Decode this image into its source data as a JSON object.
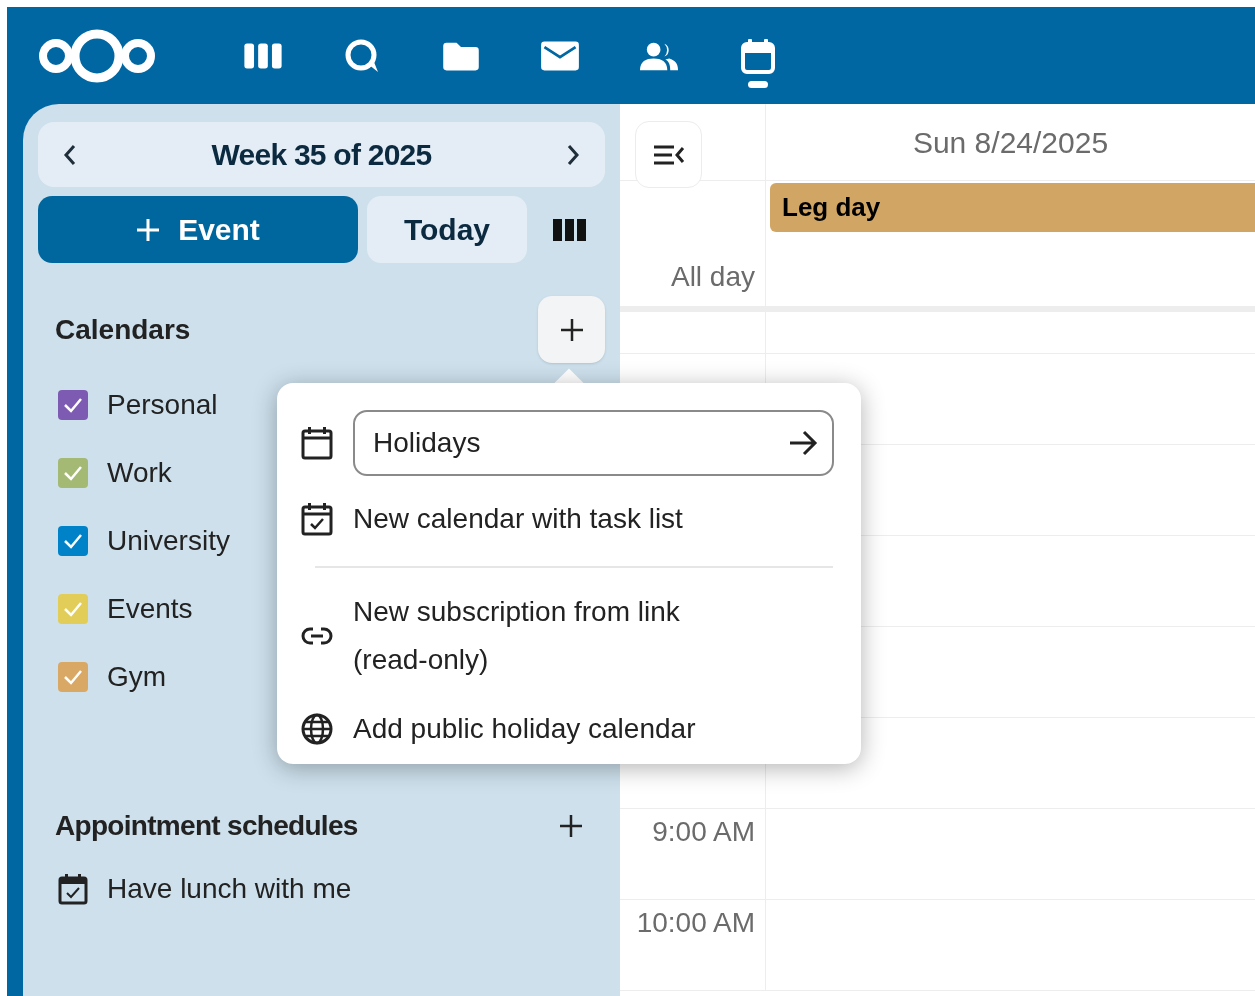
{
  "top_bar": {
    "apps": [
      {
        "kind": "dashboard",
        "selected": false
      },
      {
        "kind": "talk",
        "selected": false
      },
      {
        "kind": "files",
        "selected": false
      },
      {
        "kind": "mail",
        "selected": false
      },
      {
        "kind": "contacts",
        "selected": false
      },
      {
        "kind": "calendar",
        "selected": true
      }
    ]
  },
  "sidebar": {
    "period": "Week 35 of 2025",
    "new_event_button": "Event",
    "today_button": "Today",
    "calendars": {
      "title": "Calendars",
      "items": [
        {
          "name": "Personal",
          "color": "#7d5bb3",
          "checked": true
        },
        {
          "name": "Work",
          "color": "#a4b974",
          "checked": true
        },
        {
          "name": "University",
          "color": "#0082c9",
          "checked": true
        },
        {
          "name": "Events",
          "color": "#e2cd58",
          "checked": true
        },
        {
          "name": "Gym",
          "color": "#daa865",
          "checked": true
        }
      ]
    },
    "appointment_schedules": {
      "title": "Appointment schedules",
      "items": [
        {
          "name": "Have lunch with me"
        }
      ]
    }
  },
  "new_calendar_menu": {
    "name_field": {
      "value": "Holidays"
    },
    "items": [
      {
        "kind": "task_calendar",
        "label": "New calendar with task list"
      },
      {
        "kind": "subscription",
        "label": "New subscription from link (read-only)"
      },
      {
        "kind": "holiday",
        "label": "Add public holiday calendar"
      }
    ]
  },
  "calendar": {
    "day_header": "Sun 8/24/2025",
    "all_day_label": "All day",
    "all_day_events": [
      {
        "title": "Leg day",
        "color": "#d1a664"
      }
    ],
    "time_labels": [
      "9:00 AM",
      "10:00 AM"
    ]
  }
}
